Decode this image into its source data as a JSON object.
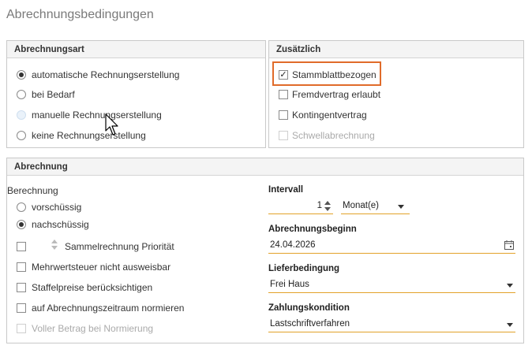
{
  "page_title": "Abrechnungsbedingungen",
  "abrechnungsart": {
    "title": "Abrechnungsart",
    "options": [
      {
        "label": "automatische Rechnungserstellung",
        "selected": true,
        "disabled": false
      },
      {
        "label": "bei Bedarf",
        "selected": false,
        "disabled": false
      },
      {
        "label": "manuelle Rechnungserstellung",
        "selected": false,
        "disabled": true
      },
      {
        "label": "keine Rechnungserstellung",
        "selected": false,
        "disabled": false
      }
    ]
  },
  "zusaetzlich": {
    "title": "Zusätzlich",
    "options": [
      {
        "label": "Stammblattbezogen",
        "checked": true,
        "disabled": false
      },
      {
        "label": "Fremdvertrag erlaubt",
        "checked": false,
        "disabled": false
      },
      {
        "label": "Kontingentvertrag",
        "checked": false,
        "disabled": false
      },
      {
        "label": "Schwellabrechnung",
        "checked": false,
        "disabled": true
      }
    ]
  },
  "abrechnung": {
    "title": "Abrechnung",
    "berechnung_label": "Berechnung",
    "berechnung_options": [
      {
        "label": "vorschüssig",
        "selected": false
      },
      {
        "label": "nachschüssig",
        "selected": true
      }
    ],
    "sammelrechnung_label": "Sammelrechnung Priorität",
    "checkboxes": [
      {
        "label": "Mehrwertsteuer nicht ausweisbar",
        "checked": false,
        "disabled": false
      },
      {
        "label": "Staffelpreise berücksichtigen",
        "checked": false,
        "disabled": false
      },
      {
        "label": "auf Abrechnungszeitraum normieren",
        "checked": false,
        "disabled": false
      },
      {
        "label": "Voller Betrag bei Normierung",
        "checked": false,
        "disabled": true
      }
    ],
    "intervall": {
      "label": "Intervall",
      "value": "1",
      "unit": "Monat(e)"
    },
    "abrechnungsbeginn": {
      "label": "Abrechnungsbeginn",
      "value": "24.04.2026"
    },
    "lieferbedingung": {
      "label": "Lieferbedingung",
      "value": "Frei Haus"
    },
    "zahlungskondition": {
      "label": "Zahlungskondition",
      "value": "Lastschriftverfahren"
    }
  },
  "colors": {
    "accent": "#e2a229",
    "highlight": "#e06b2a"
  }
}
